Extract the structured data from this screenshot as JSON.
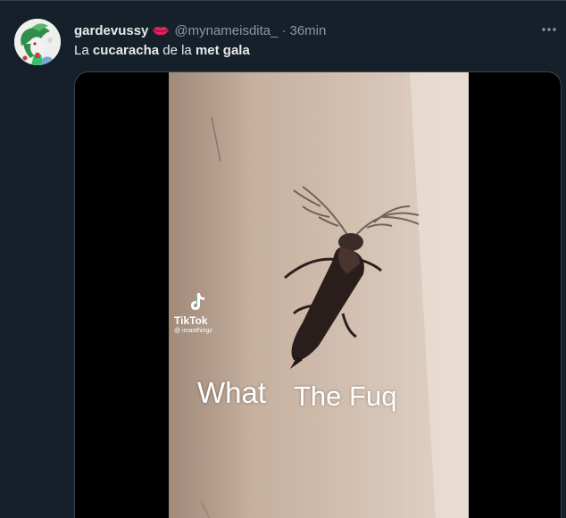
{
  "tweet": {
    "display_name": "gardevussy",
    "handle": "@mynameisdita_",
    "separator": "·",
    "time": "36min",
    "text": {
      "part1": "La ",
      "part2": "cucaracha",
      "part3": " de la ",
      "part4": "met gala"
    }
  },
  "video": {
    "watermark": "TikTok",
    "watermark_user": "@ imaothingz",
    "caption_1": "What",
    "caption_2": "The Fuq"
  },
  "icons": {
    "avatar": "gardevoir-avatar",
    "name_emoji": "lips-icon",
    "more": "more-icon",
    "tiktok": "tiktok-logo-icon"
  },
  "colors": {
    "background": "#15202b",
    "text_primary": "#e7e9ea",
    "text_secondary": "#8b98a5",
    "border": "#38444d"
  }
}
